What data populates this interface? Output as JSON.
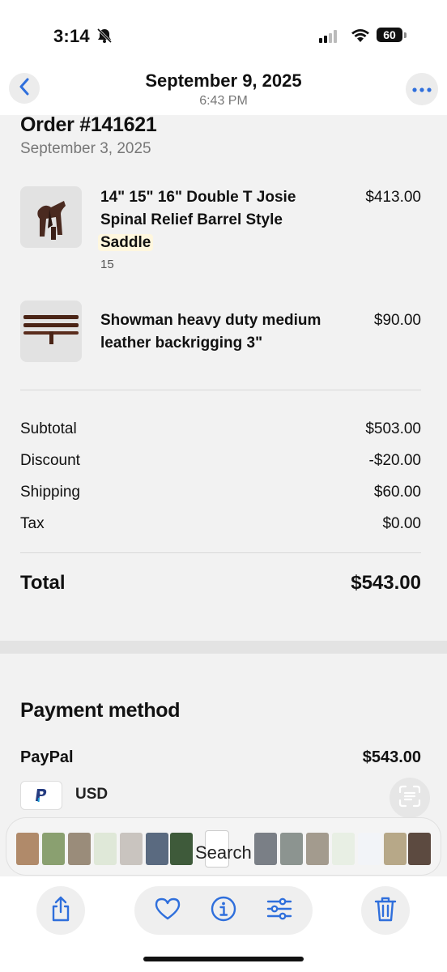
{
  "status_bar": {
    "time": "3:14",
    "battery": "60"
  },
  "header": {
    "date": "September 9, 2025",
    "time": "6:43 PM"
  },
  "order": {
    "title": "Order #141621",
    "date": "September 3, 2025"
  },
  "items": [
    {
      "name_lines": [
        "14\" 15\" 16\" Double T Josie",
        "Spinal Relief Barrel Style"
      ],
      "name_highlight": "Saddle",
      "variant": "15",
      "price": "$413.00"
    },
    {
      "name_lines": [
        "Showman heavy duty medium",
        "leather backrigging 3\""
      ],
      "price": "$90.00"
    }
  ],
  "summary": {
    "subtotal_label": "Subtotal",
    "subtotal": "$503.00",
    "discount_label": "Discount",
    "discount": "-$20.00",
    "shipping_label": "Shipping",
    "shipping": "$60.00",
    "tax_label": "Tax",
    "tax": "$0.00",
    "total_label": "Total",
    "total": "$543.00"
  },
  "payment": {
    "title": "Payment method",
    "method": "PayPal",
    "amount": "$543.00",
    "currency": "USD"
  },
  "filmstrip": {
    "overlay_text": "Search"
  },
  "colors": {
    "accent": "#2f6fdc",
    "paypal": "#253b80"
  },
  "icons": [
    "back-chevron-icon",
    "more-icon",
    "live-text-icon",
    "share-icon",
    "heart-icon",
    "info-icon",
    "adjust-icon",
    "trash-icon"
  ]
}
